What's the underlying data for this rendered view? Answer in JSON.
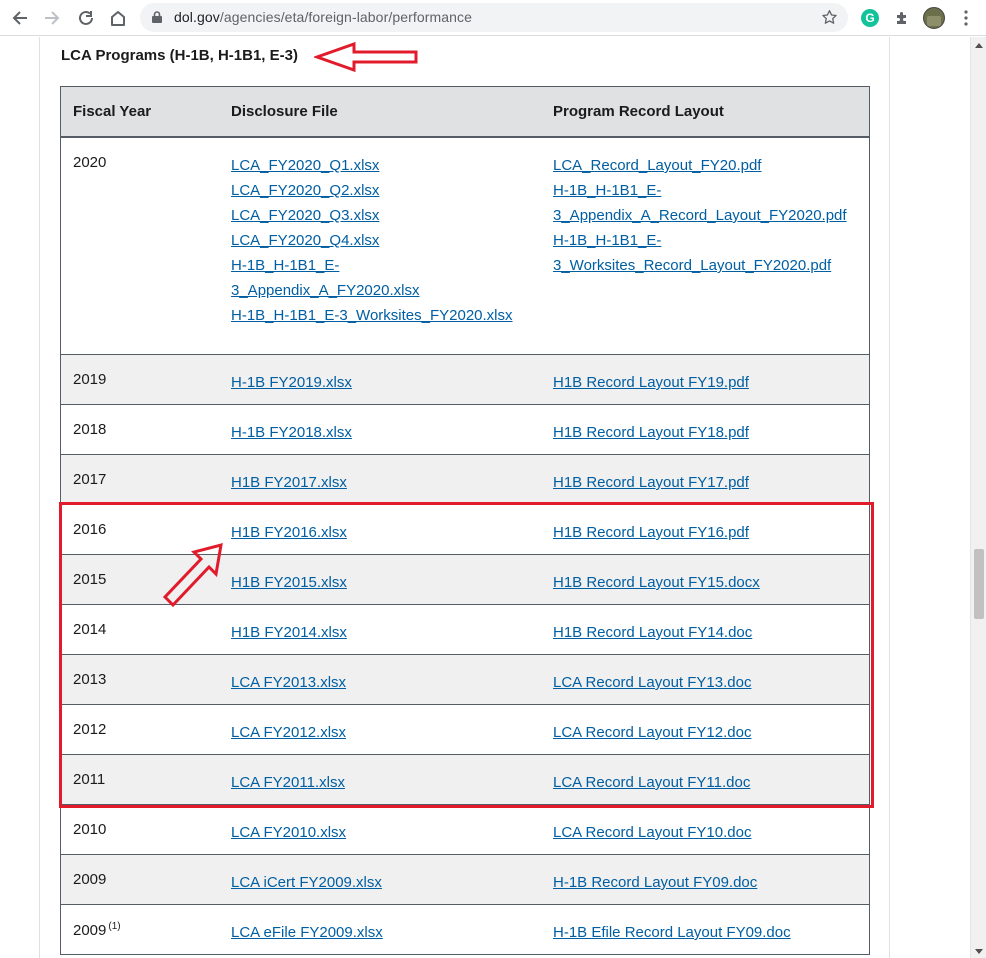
{
  "browser": {
    "url_host": "dol.gov",
    "url_path": "/agencies/eta/foreign-labor/performance",
    "extension_letter": "G"
  },
  "section": {
    "title": "LCA Programs (H-1B, H-1B1, E-3)"
  },
  "table": {
    "headers": {
      "fiscal_year": "Fiscal Year",
      "disclosure_file": "Disclosure File",
      "record_layout": "Program Record Layout"
    },
    "rows": [
      {
        "year": "2020",
        "files": [
          "LCA_FY2020_Q1.xlsx",
          "LCA_FY2020_Q2.xlsx",
          "LCA_FY2020_Q3.xlsx",
          "LCA_FY2020_Q4.xlsx",
          "H-1B_H-1B1_E-",
          "3_Appendix_A_FY2020.xlsx",
          "H-1B_H-1B1_E-3_Worksites_FY2020.xlsx"
        ],
        "layouts": [
          "LCA_Record_Layout_FY20.pdf",
          "H-1B_H-1B1_E-",
          "3_Appendix_A_Record_Layout_FY2020.pdf",
          "H-1B_H-1B1_E-",
          "3_Worksites_Record_Layout_FY2020.pdf"
        ]
      },
      {
        "year": "2019",
        "files": [
          "H-1B FY2019.xlsx"
        ],
        "layouts": [
          "H1B Record Layout FY19.pdf"
        ]
      },
      {
        "year": "2018",
        "files": [
          "H-1B FY2018.xlsx"
        ],
        "layouts": [
          "H1B Record Layout FY18.pdf"
        ]
      },
      {
        "year": "2017",
        "files": [
          "H1B FY2017.xlsx"
        ],
        "layouts": [
          "H1B Record Layout FY17.pdf"
        ]
      },
      {
        "year": "2016",
        "files": [
          "H1B FY2016.xlsx"
        ],
        "layouts": [
          "H1B Record Layout FY16.pdf"
        ]
      },
      {
        "year": "2015",
        "files": [
          "H1B FY2015.xlsx"
        ],
        "layouts": [
          "H1B Record Layout FY15.docx"
        ]
      },
      {
        "year": "2014",
        "files": [
          "H1B FY2014.xlsx"
        ],
        "layouts": [
          "H1B Record Layout FY14.doc"
        ]
      },
      {
        "year": "2013",
        "files": [
          "LCA FY2013.xlsx"
        ],
        "layouts": [
          "LCA Record Layout FY13.doc"
        ]
      },
      {
        "year": "2012",
        "files": [
          "LCA FY2012.xlsx"
        ],
        "layouts": [
          "LCA Record Layout FY12.doc"
        ]
      },
      {
        "year": "2011",
        "files": [
          "LCA FY2011.xlsx"
        ],
        "layouts": [
          "LCA Record Layout FY11.doc"
        ]
      },
      {
        "year": "2010",
        "files": [
          "LCA FY2010.xlsx"
        ],
        "layouts": [
          "LCA Record Layout FY10.doc"
        ]
      },
      {
        "year": "2009",
        "files": [
          "LCA iCert FY2009.xlsx"
        ],
        "layouts": [
          "H-1B Record Layout FY09.doc"
        ]
      },
      {
        "year": "2009",
        "footnote": "(1)",
        "files": [
          "LCA eFile FY2009.xlsx"
        ],
        "layouts": [
          "H-1B Efile Record Layout FY09.doc"
        ]
      }
    ]
  },
  "colors": {
    "link": "#005ea2",
    "annotation_red": "#e11b2b",
    "header_bg": "#dfe1e2",
    "alt_row_bg": "#f0f0f0"
  },
  "icons": [
    "back-arrow-icon",
    "forward-arrow-icon",
    "reload-icon",
    "home-icon",
    "lock-icon",
    "bookmark-star-icon",
    "grammarly-icon",
    "extensions-puzzle-icon",
    "profile-avatar",
    "kebab-menu-icon",
    "annotation-arrow-icon"
  ]
}
